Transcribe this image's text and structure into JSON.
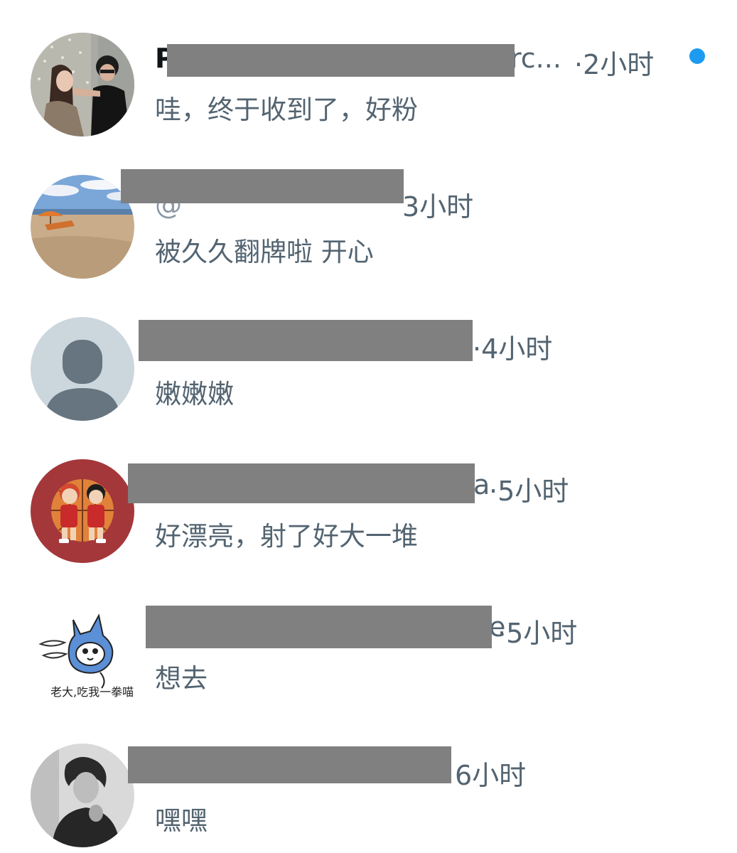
{
  "accent_color": "#1d9bf0",
  "replies": [
    {
      "name_visible": "P",
      "name_trailing": "rc...",
      "time": "·2小时",
      "text": "哇，终于收到了，好粉",
      "unread": true,
      "avatar": "photo-couple-icon"
    },
    {
      "name_trailing": "3小时",
      "handle_partial": "@",
      "time": "",
      "text": "被久久翻牌啦 开心",
      "unread": false,
      "avatar": "photo-beach-icon"
    },
    {
      "name_trailing": "",
      "time": "·4小时",
      "text": "嫩嫩嫩",
      "unread": false,
      "avatar": "default-person-icon"
    },
    {
      "name_trailing": "a",
      "time": "·5小时",
      "text": "好漂亮，射了好大一堆",
      "unread": false,
      "avatar": "cartoon-basketball-icon"
    },
    {
      "name_trailing": "e",
      "time": "·5小时",
      "text": "想去",
      "unread": false,
      "avatar": "cartoon-cat-icon",
      "avatar_caption": "老大,吃我一拳喵"
    },
    {
      "name_trailing": "",
      "time": "6小时",
      "text": "嘿嘿",
      "unread": false,
      "avatar": "photo-bw-portrait-icon"
    }
  ]
}
